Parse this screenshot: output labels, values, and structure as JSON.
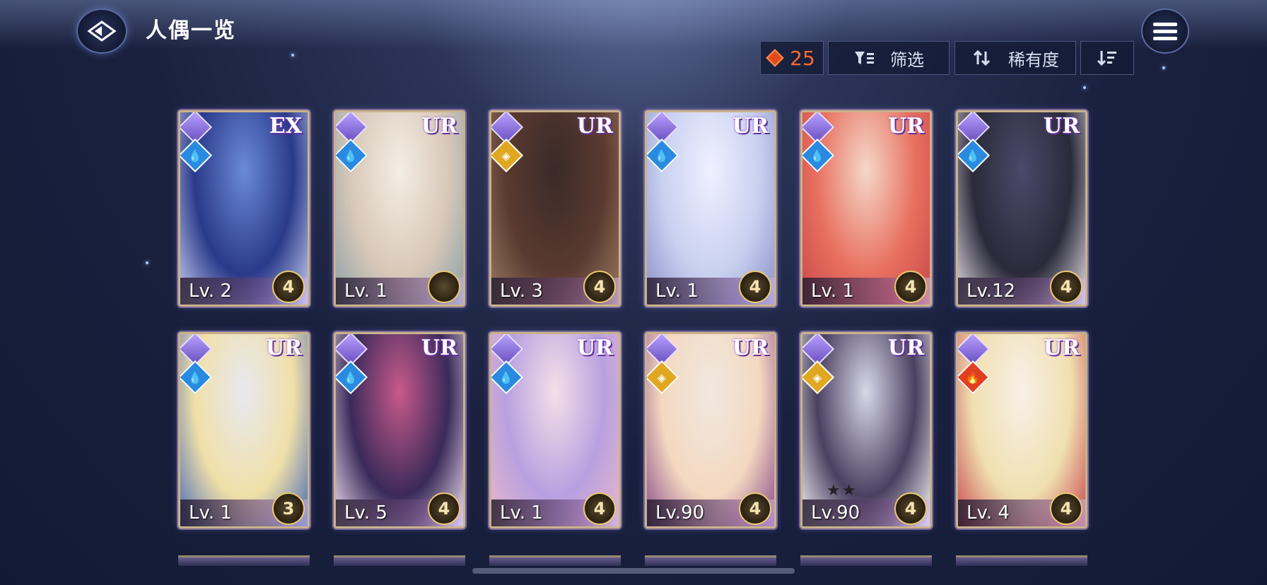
{
  "header": {
    "title": "人偶一览"
  },
  "toolbar": {
    "count": "25",
    "filter_label": "筛选",
    "sort_label": "稀有度"
  },
  "colors": {
    "accent_orange": "#ff6a2a",
    "frame_gold": "#c9b38a"
  },
  "cards": [
    {
      "rarity": "EX",
      "level": "Lv. 2",
      "star": "4",
      "element": "water-icon",
      "art": "#2a3a8a,#6a8ad8,#c8d0f0"
    },
    {
      "rarity": "UR",
      "level": "Lv. 1",
      "star": "",
      "element": "water-icon",
      "art": "#d8c8b8,#f4eee4,#8aa0a8"
    },
    {
      "rarity": "UR",
      "level": "Lv. 3",
      "star": "4",
      "element": "light-icon",
      "art": "#5a3a30,#3a2a28,#9a7a60"
    },
    {
      "rarity": "UR",
      "level": "Lv. 1",
      "star": "4",
      "element": "water-icon",
      "art": "#c8d0f0,#f0f0ff,#8a90c8"
    },
    {
      "rarity": "UR",
      "level": "Lv. 1",
      "star": "4",
      "element": "water-icon",
      "art": "#e87060,#f4d8c8,#c84848"
    },
    {
      "rarity": "UR",
      "level": "Lv.12",
      "star": "4",
      "element": "water-icon",
      "art": "#2a2a3a,#4a4a6a,#e8e0e8"
    },
    {
      "rarity": "UR",
      "level": "Lv. 1",
      "star": "3",
      "element": "water-icon",
      "art": "#f0e0a8,#e8e8f0,#4a6ab8"
    },
    {
      "rarity": "UR",
      "level": "Lv. 5",
      "star": "4",
      "element": "water-icon",
      "art": "#3a2a5a,#c85a8a,#f0e0f0"
    },
    {
      "rarity": "UR",
      "level": "Lv. 1",
      "star": "4",
      "element": "water-icon",
      "art": "#b8a0e0,#f4e0e8,#e8b8c8"
    },
    {
      "rarity": "UR",
      "level": "Lv.90",
      "star": "4",
      "element": "light-icon",
      "art": "#f4d8c0,#f0e8e0,#8a4a8a"
    },
    {
      "rarity": "UR",
      "level": "Lv.90",
      "star": "4",
      "element": "light-icon",
      "art": "#4a4060,#d8d8e8,#f4f4f8",
      "sub_stars": "★★"
    },
    {
      "rarity": "UR",
      "level": "Lv. 4",
      "star": "4",
      "element": "fire-icon",
      "art": "#f0e0b0,#f8f0e8,#c84850"
    }
  ]
}
